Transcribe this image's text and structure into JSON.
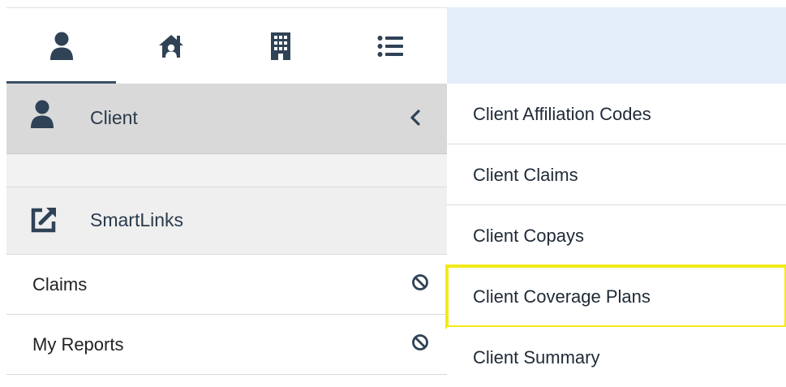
{
  "tabs": [
    {
      "icon": "user-icon",
      "active": true
    },
    {
      "icon": "home-icon",
      "active": false
    },
    {
      "icon": "building-icon",
      "active": false
    },
    {
      "icon": "list-icon",
      "active": false
    }
  ],
  "sidebar": {
    "client_label": "Client",
    "smartlinks_label": "SmartLinks",
    "items": [
      {
        "label": "Claims"
      },
      {
        "label": "My Reports"
      }
    ]
  },
  "submenu": {
    "items": [
      {
        "label": "Client Affiliation Codes"
      },
      {
        "label": "Client Claims"
      },
      {
        "label": "Client Copays"
      },
      {
        "label": "Client Coverage Plans",
        "highlighted": true
      },
      {
        "label": "Client Summary"
      }
    ]
  },
  "colors": {
    "icon": "#2f4256",
    "active_tab_underline": "#3b5066",
    "client_row_bg": "#d9d9d9",
    "top_band_bg": "#e3eef9",
    "highlight": "#f2ea1a"
  }
}
